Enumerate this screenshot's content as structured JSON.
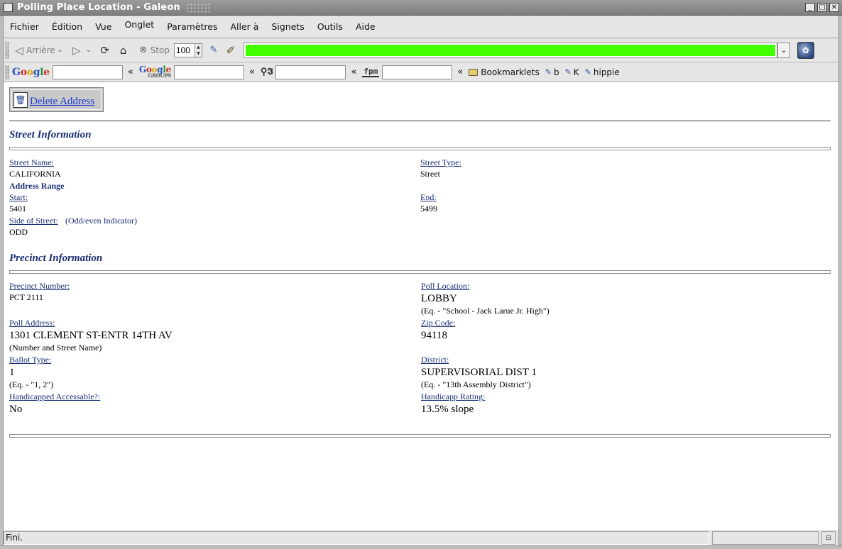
{
  "window": {
    "title": "Polling Place Location - Galeon",
    "minimize_glyph": "_",
    "maximize_glyph": "□",
    "close_glyph": "✕"
  },
  "menu": {
    "items": [
      "Fichier",
      "Édition",
      "Vue",
      "Onglet",
      "Paramètres",
      "Aller à",
      "Signets",
      "Outils",
      "Aide"
    ]
  },
  "toolbar": {
    "back_label": "Arrière",
    "stop_label": "Stop",
    "zoom_value": "100",
    "url_color": "#44ff00",
    "icons": [
      "back-arrow-icon",
      "dropdown-arrow-icon",
      "forward-arrow-icon",
      "reload-icon",
      "home-icon",
      "stop-icon",
      "spinner-icon",
      "broom-icon",
      "galeon-logo-icon"
    ]
  },
  "searchbar": {
    "engines": [
      {
        "name": "Google",
        "icon": "google-logo-icon"
      },
      {
        "name": "Google Groups",
        "icon": "google-groups-logo-icon",
        "small": "GROUPS"
      },
      {
        "name": "dictionary",
        "icon": "dictionary-icon"
      },
      {
        "name": "fpm",
        "icon": "fpm-icon",
        "label": "fpm"
      }
    ],
    "separator": "«",
    "bookmarks": [
      {
        "label": "Bookmarklets",
        "icon": "folder-icon"
      },
      {
        "label": "b",
        "icon": "bookmarklet-icon"
      },
      {
        "label": "K",
        "icon": "bookmarklet-icon"
      },
      {
        "label": "hippie",
        "icon": "bookmarklet-icon"
      }
    ]
  },
  "page": {
    "delete_label": "Delete Address",
    "street_section": "Street Information",
    "street_name_label": "Street Name:",
    "street_name": "CALIFORNIA",
    "street_type_label": "Street Type:",
    "street_type": "Street",
    "address_range_label": "Address Range",
    "start_label": "Start:",
    "start_value": "5401",
    "end_label": "End:",
    "end_value": "5499",
    "side_label": "Side of Street:",
    "side_hint": "(Odd/even Indicator)",
    "side_value": "ODD",
    "precinct_section": "Precinct Information",
    "precinct_number_label": "Precinct Number:",
    "precinct_number": "PCT 2111",
    "poll_location_label": "Poll Location:",
    "poll_location": "LOBBY",
    "poll_location_hint": "(Eq. - \"School - Jack Larue Jr. High\")",
    "poll_address_label": "Poll Address:",
    "poll_address": "1301 CLEMENT ST-ENTR 14TH AV",
    "poll_address_hint": "(Number and Street Name)",
    "zip_label": "Zip Code:",
    "zip_value": "94118",
    "ballot_label": "Ballot Type:",
    "ballot_value": "1",
    "ballot_hint": "(Eq. - \"1, 2\")",
    "district_label": "District:",
    "district_value": "SUPERVISORIAL DIST 1",
    "district_hint": "(Eq. - \"13th Assembly District\")",
    "handicap_access_label": "Handicapped Accessable?:",
    "handicap_access_value": "No",
    "handicap_rating_label": "Handicapp Rating:",
    "handicap_rating_value": "13.5% slope"
  },
  "status": {
    "text": "Fini."
  }
}
